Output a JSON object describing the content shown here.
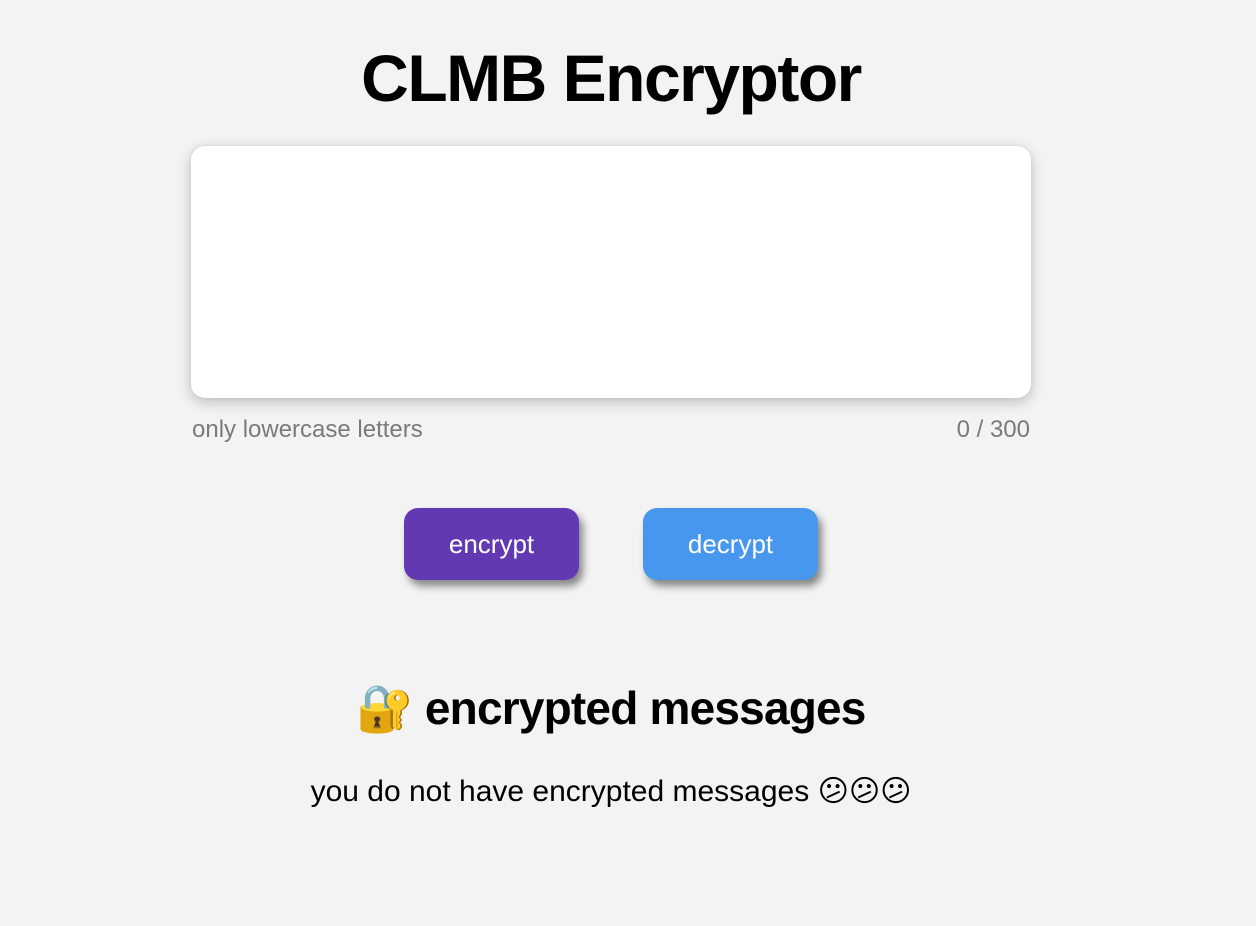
{
  "app": {
    "title": "CLMB Encryptor"
  },
  "editor": {
    "value": "",
    "placeholder": "",
    "hint": "only lowercase letters",
    "counter": "0 / 300"
  },
  "actions": {
    "encrypt_label": "encrypt",
    "decrypt_label": "decrypt"
  },
  "messages": {
    "icon": "🔐",
    "title": "encrypted messages",
    "empty_text": "you do not have encrypted messages",
    "empty_emoji": "😕😕😕"
  },
  "colors": {
    "background": "#f3f3f3",
    "encrypt_button": "#6339b3",
    "decrypt_button": "#4897ee",
    "muted_text": "#7a7a7a"
  },
  "icons": {
    "section_icon": "lock-with-key-icon",
    "empty_icon": "confused-face-icon"
  }
}
